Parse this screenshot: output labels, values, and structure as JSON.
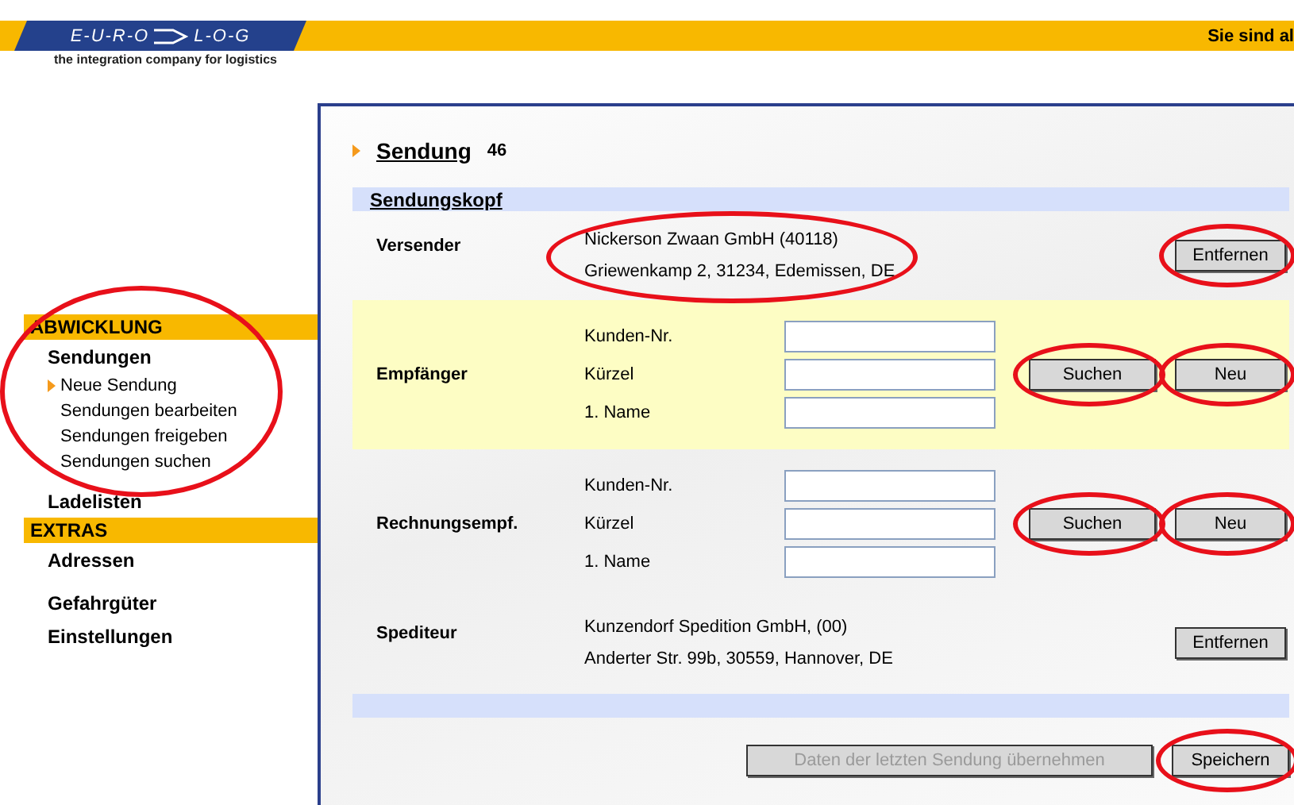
{
  "header": {
    "logo_left": "E-U-R-O",
    "logo_right": "L-O-G",
    "tagline": "the integration company for logistics",
    "user_note": "Sie sind al"
  },
  "sidebar": [
    {
      "title": "ABWICKLUNG",
      "circled": true,
      "items": [
        {
          "label": "Sendungen",
          "children": [
            {
              "label": "Neue Sendung",
              "selected": true
            },
            {
              "label": "Sendungen bearbeiten",
              "selected": false
            },
            {
              "label": "Sendungen freigeben",
              "selected": false
            },
            {
              "label": "Sendungen suchen",
              "selected": false
            }
          ]
        },
        {
          "label": "Ladelisten"
        }
      ]
    },
    {
      "title": "EXTRAS",
      "items": [
        {
          "label": "Adressen"
        },
        {
          "label": "Gefahrgüter"
        },
        {
          "label": "Einstellungen"
        }
      ]
    }
  ],
  "page": {
    "title": "Sendung",
    "count": "46",
    "section": "Sendungskopf"
  },
  "parties": [
    {
      "kind": "address",
      "label": "Versender",
      "highlighted": false,
      "lines": [
        "Nickerson Zwaan GmbH (40118)",
        "Griewenkamp 2, 31234, Edemissen, DE"
      ],
      "circled": true,
      "buttons": [
        {
          "label": "Entfernen",
          "circled": true
        }
      ]
    },
    {
      "kind": "lookup",
      "label": "Empfänger",
      "highlighted": true,
      "fields": [
        {
          "label": "Kunden-Nr."
        },
        {
          "label": "Kürzel"
        },
        {
          "label": "1. Name"
        }
      ],
      "buttons": [
        {
          "label": "Suchen",
          "circled": true
        },
        {
          "label": "Neu",
          "circled": true
        }
      ]
    },
    {
      "kind": "lookup",
      "label": "Rechnungsempf.",
      "highlighted": false,
      "fields": [
        {
          "label": "Kunden-Nr."
        },
        {
          "label": "Kürzel"
        },
        {
          "label": "1. Name"
        }
      ],
      "buttons": [
        {
          "label": "Suchen",
          "circled": true
        },
        {
          "label": "Neu",
          "circled": true
        }
      ]
    },
    {
      "kind": "address",
      "label": "Spediteur",
      "highlighted": false,
      "lines": [
        "Kunzendorf Spedition GmbH, (00)",
        "Anderter Str. 99b, 30559, Hannover, DE"
      ],
      "buttons": [
        {
          "label": "Entfernen"
        }
      ]
    }
  ],
  "footer_buttons": [
    {
      "label": "Daten der letzten Sendung übernehmen",
      "disabled": true
    },
    {
      "label": "Speichern",
      "disabled": false,
      "circled": true
    }
  ]
}
